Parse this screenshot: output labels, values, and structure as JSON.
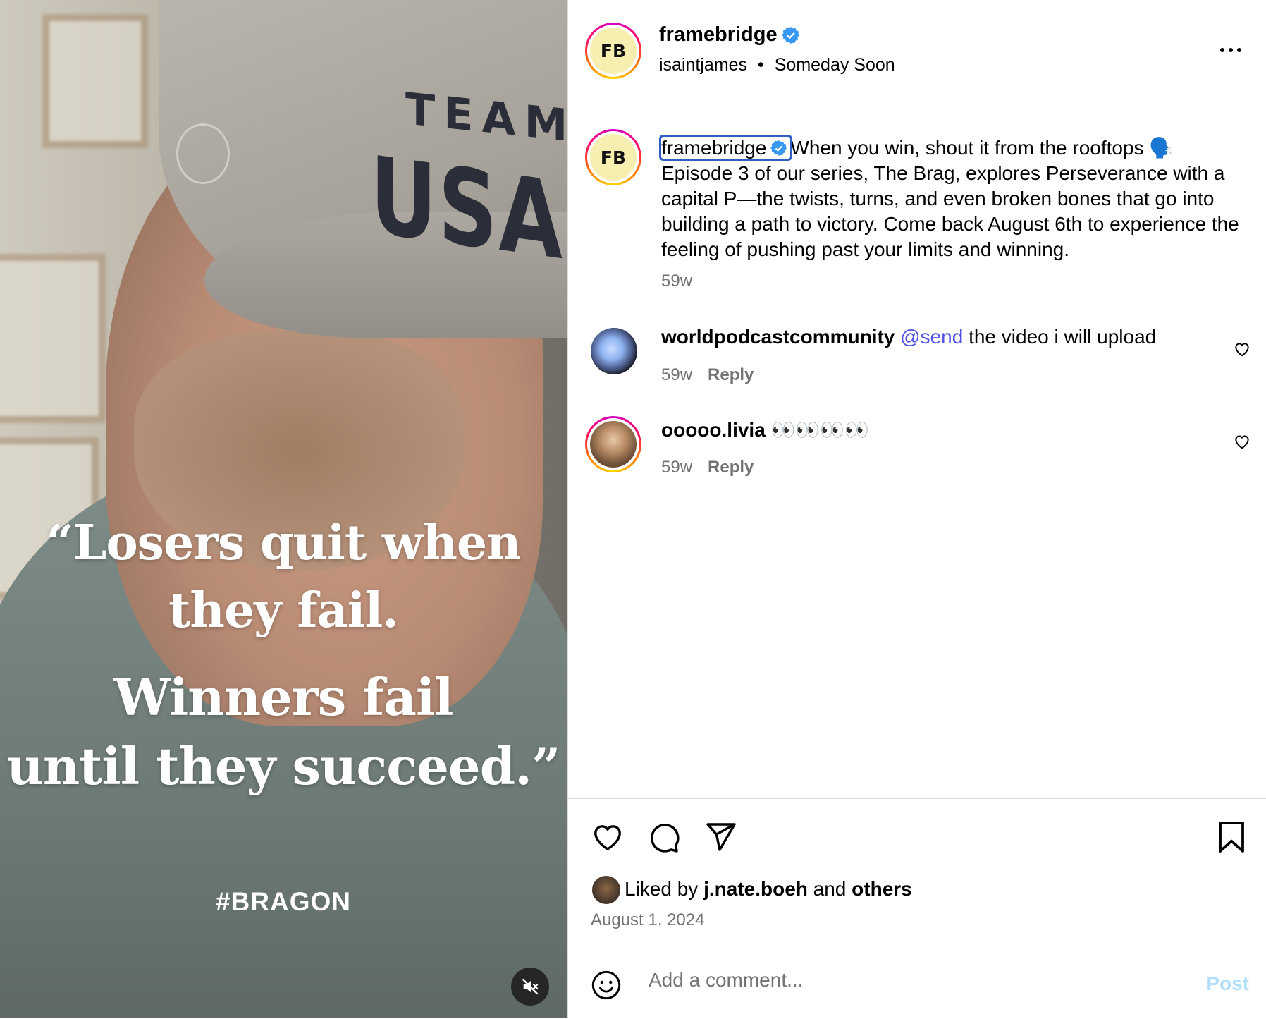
{
  "media": {
    "cap_text_top": "TEAM",
    "cap_text_bottom": "USA",
    "quote_line1": "“Losers quit when",
    "quote_line2": "they fail.",
    "quote_line3": "Winners fail",
    "quote_line4": "until they succeed.”",
    "hashtag": "#BRAGON",
    "mute_icon": "muted-speaker-icon"
  },
  "header": {
    "avatar_text": "FB",
    "username": "framebridge",
    "verified": true,
    "collaborator": "isaintjames",
    "separator": "•",
    "audio": "Someday Soon"
  },
  "caption": {
    "username": "framebridge",
    "text_line1": "When you win, shout it from the rooftops 🗣️",
    "text_rest": "Episode 3 of our series, The Brag, explores Perseverance with a capital P—the twists, turns, and even broken bones that go into building a path to victory. Come back August 6th to experience the feeling of pushing past your limits and winning.",
    "time": "59w"
  },
  "comments": [
    {
      "username": "worldpodcastcommunity",
      "mention": "@send",
      "text": "the video i will upload",
      "time": "59w",
      "reply_label": "Reply"
    },
    {
      "username": "ooooo.livia",
      "mention": "",
      "text": "👀👀👀👀",
      "time": "59w",
      "reply_label": "Reply"
    }
  ],
  "actions": {
    "liked_prefix": "Liked by",
    "liked_user": "j.nate.boeh",
    "liked_and": "and",
    "liked_others": "others",
    "date": "August 1, 2024"
  },
  "comment_box": {
    "placeholder": "Add a comment...",
    "post_label": "Post"
  },
  "colors": {
    "verified": "#3897f0",
    "mention": "#4f52e6",
    "post_disabled": "#b2dffc",
    "muted_text": "#737373"
  }
}
